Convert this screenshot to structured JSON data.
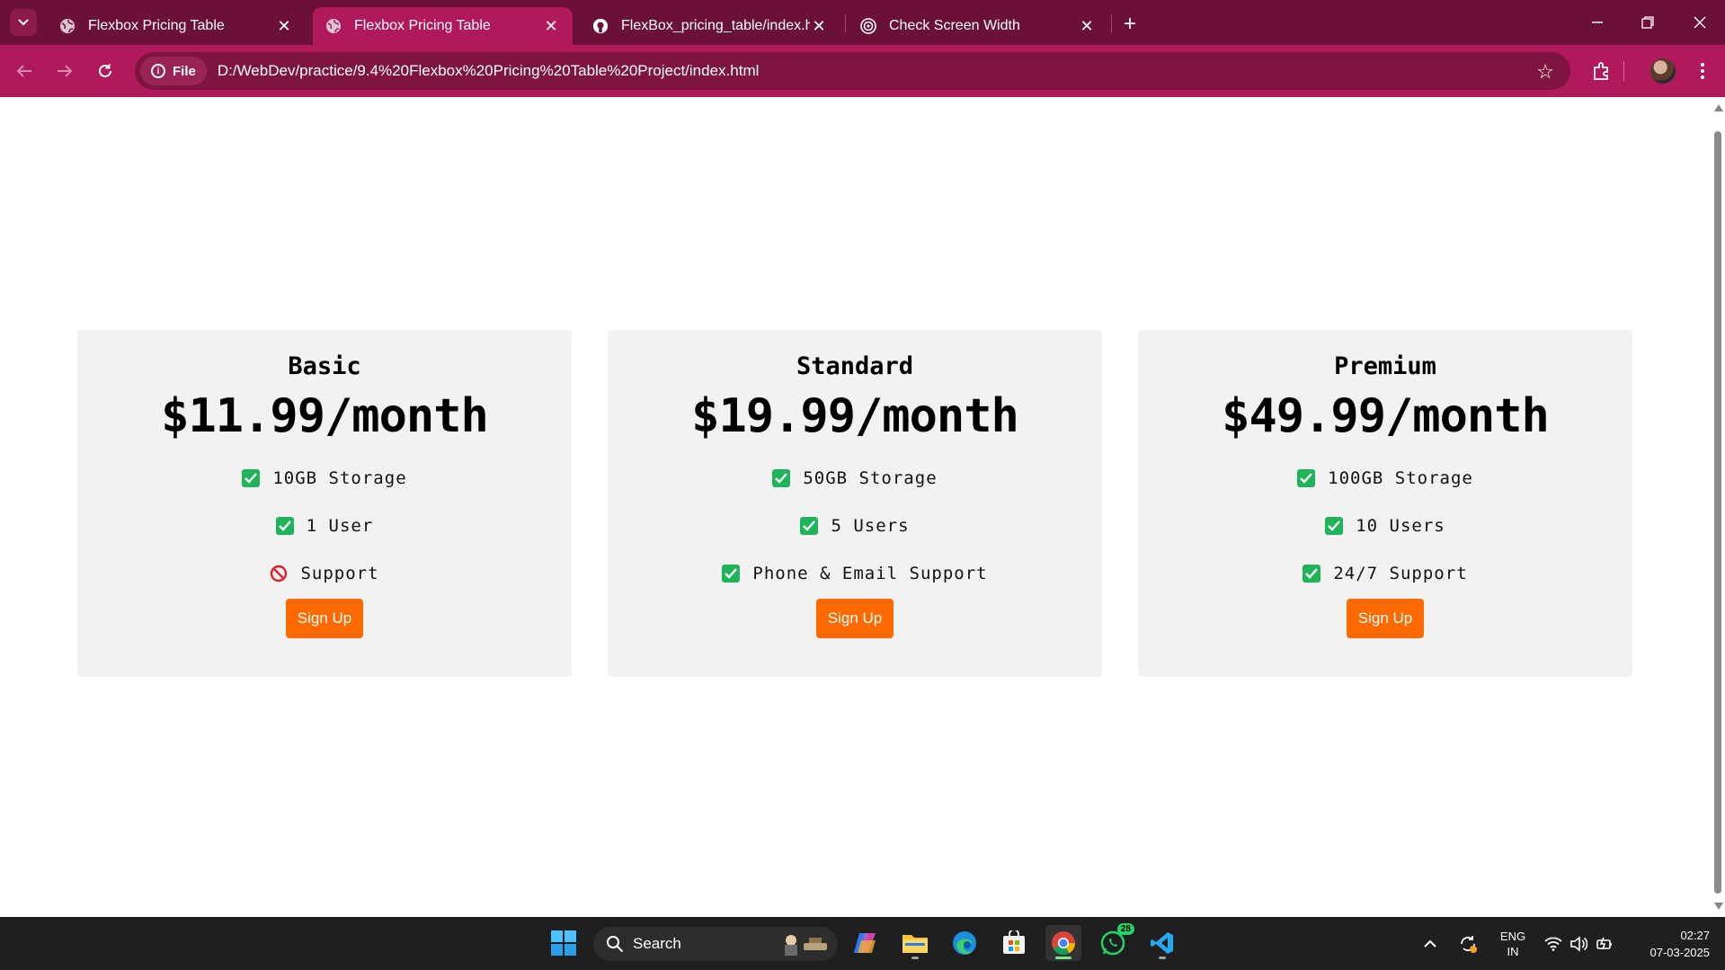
{
  "browser": {
    "tabs": [
      {
        "title": "Flexbox Pricing Table",
        "active": false
      },
      {
        "title": "Flexbox Pricing Table",
        "active": true
      },
      {
        "title": "FlexBox_pricing_table/index.htm",
        "active": false
      },
      {
        "title": "Check Screen Width",
        "active": false
      }
    ],
    "address": {
      "scheme_label": "File",
      "url": "D:/WebDev/practice/9.4%20Flexbox%20Pricing%20Table%20Project/index.html"
    },
    "theme_color": "#b01a5c"
  },
  "page": {
    "plans": [
      {
        "name": "Basic",
        "price": "$11.99/month",
        "features": [
          {
            "text": "10GB Storage",
            "included": true
          },
          {
            "text": "1 User",
            "included": true
          },
          {
            "text": "Support",
            "included": false
          }
        ],
        "button": "Sign Up"
      },
      {
        "name": "Standard",
        "price": "$19.99/month",
        "features": [
          {
            "text": "50GB Storage",
            "included": true
          },
          {
            "text": "5 Users",
            "included": true
          },
          {
            "text": "Phone & Email Support",
            "included": true
          }
        ],
        "button": "Sign Up"
      },
      {
        "name": "Premium",
        "price": "$49.99/month",
        "features": [
          {
            "text": "100GB Storage",
            "included": true
          },
          {
            "text": "10 Users",
            "included": true
          },
          {
            "text": "24/7 Support",
            "included": true
          }
        ],
        "button": "Sign Up"
      }
    ],
    "colors": {
      "card_bg": "#f2f2f2",
      "button": "#ff6a00",
      "check": "#1fb45a",
      "no": "#e0202a"
    }
  },
  "taskbar": {
    "search_label": "Search",
    "whatsapp_badge": "28",
    "language": {
      "line1": "ENG",
      "line2": "IN"
    },
    "time": "02:27",
    "date": "07-03-2025"
  }
}
